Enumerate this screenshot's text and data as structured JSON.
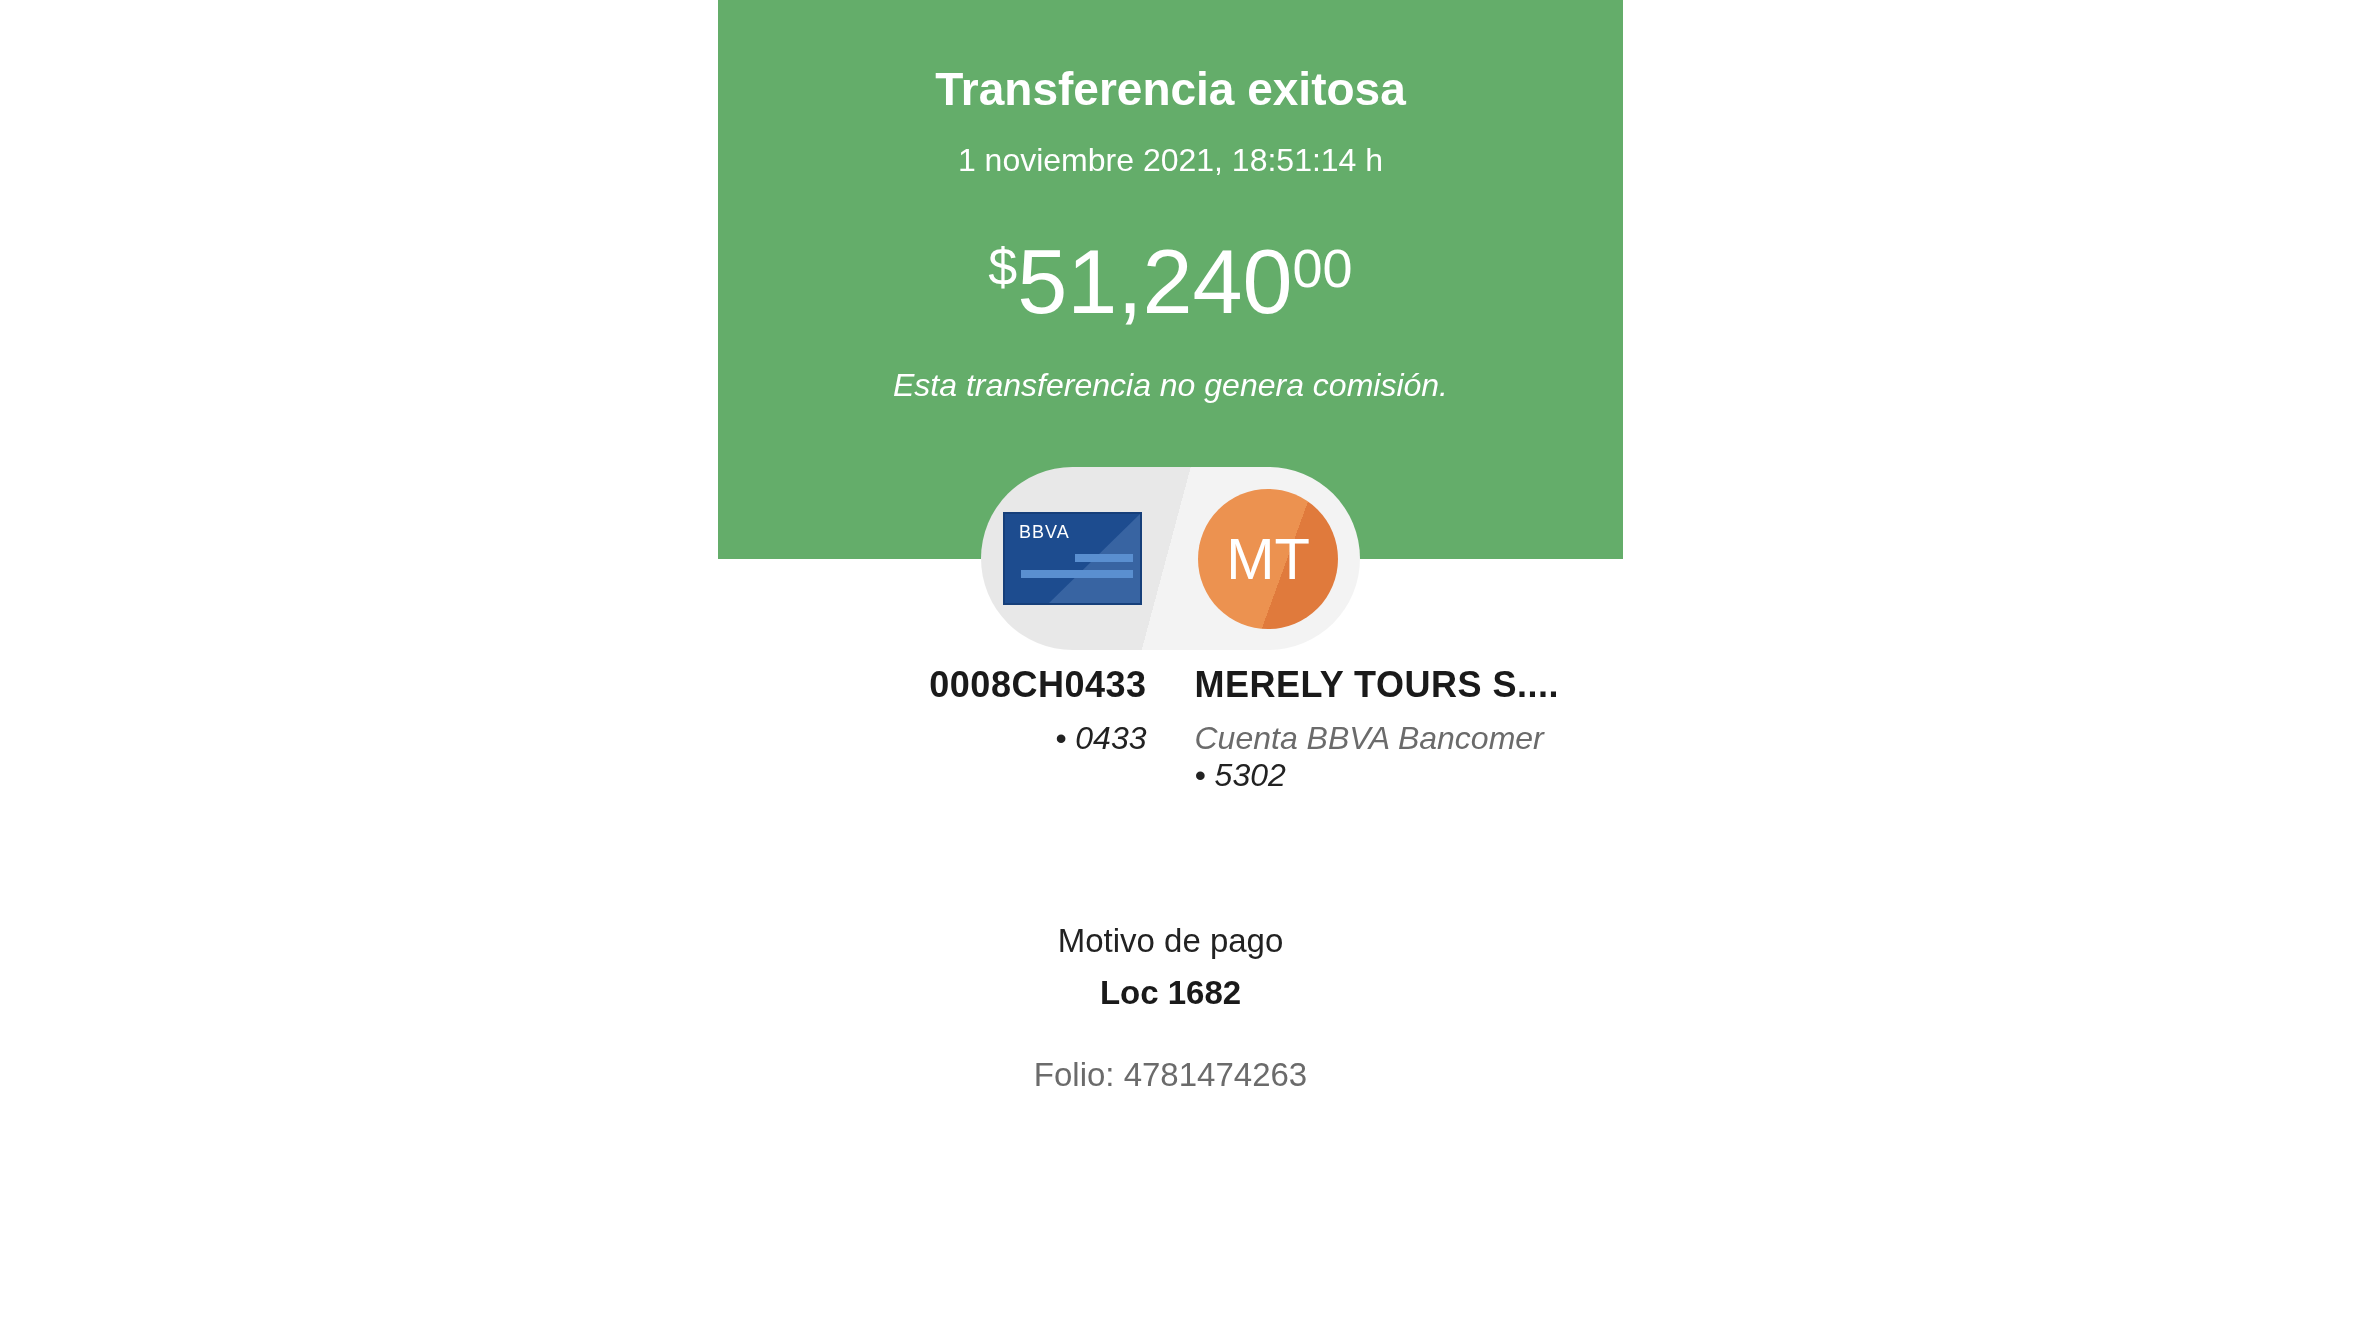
{
  "header": {
    "title": "Transferencia exitosa",
    "datetime": "1 noviembre 2021, 18:51:14 h",
    "amount": {
      "currency": "$",
      "whole": "51,240",
      "cents": "00"
    },
    "note": "Esta transferencia no genera comisión."
  },
  "transfer": {
    "card_label": "BBVA",
    "initials": "MT",
    "origin": {
      "name": "0008CH0433",
      "lines": [
        "• 0433"
      ]
    },
    "destination": {
      "name": "MERELY TOURS S....",
      "bank": "Cuenta BBVA Bancomer",
      "lines": [
        "• 5302"
      ]
    }
  },
  "details": {
    "label": "Motivo de pago",
    "value": "Loc 1682",
    "folio": "Folio: 4781474263"
  }
}
